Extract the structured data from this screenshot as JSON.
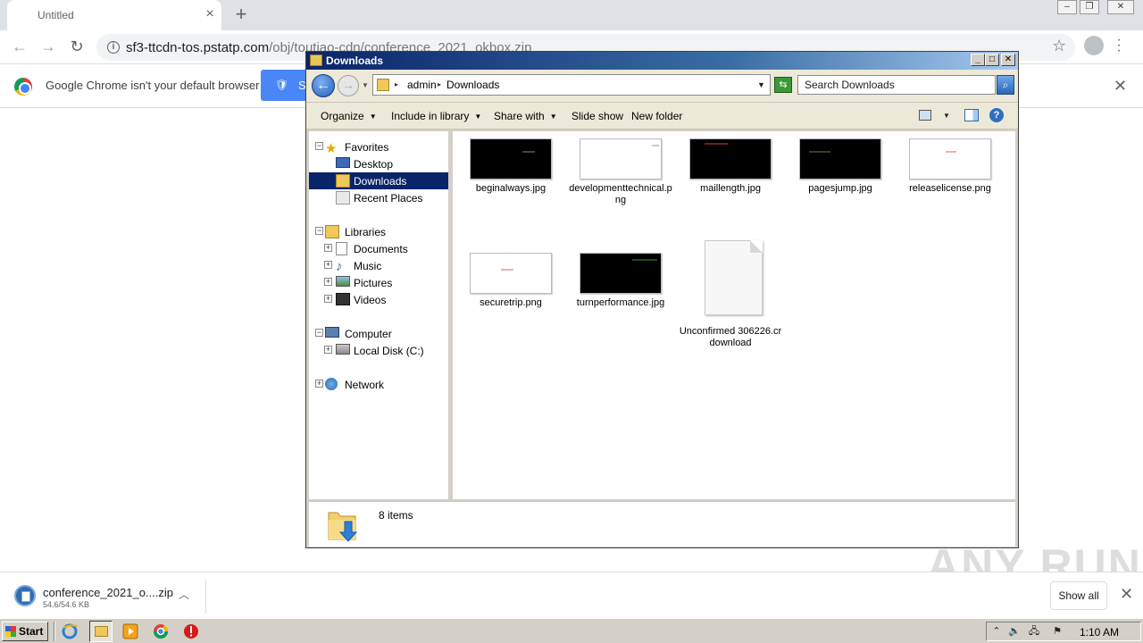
{
  "browser": {
    "tab_title": "Untitled",
    "url_host": "sf3-ttcdn-tos.pstatp.com",
    "url_path": "/obj/toutiao-cdn/conference_2021_okbox.zip",
    "infobar_text": "Google Chrome isn't your default browser",
    "set_default_label": "S"
  },
  "explorer": {
    "title": "Downloads",
    "breadcrumbs": [
      "admin",
      "Downloads"
    ],
    "search_placeholder": "Search Downloads",
    "commands": [
      "Organize",
      "Include in library",
      "Share with",
      "Slide show",
      "New folder"
    ],
    "tree": {
      "favorites": "Favorites",
      "desktop": "Desktop",
      "downloads": "Downloads",
      "recent": "Recent Places",
      "libraries": "Libraries",
      "documents": "Documents",
      "music": "Music",
      "pictures": "Pictures",
      "videos": "Videos",
      "computer": "Computer",
      "local_disk": "Local Disk (C:)",
      "network": "Network"
    },
    "files": [
      {
        "name": "beginalways.jpg",
        "thumb": "dark"
      },
      {
        "name": "developmenttechnical.png",
        "thumb": "light"
      },
      {
        "name": "maillength.jpg",
        "thumb": "dark"
      },
      {
        "name": "pagesjump.jpg",
        "thumb": "dark"
      },
      {
        "name": "releaselicense.png",
        "thumb": "light"
      },
      {
        "name": "securetrip.png",
        "thumb": "light"
      },
      {
        "name": "turnperformance.jpg",
        "thumb": "dark"
      },
      {
        "name": "Unconfirmed 306226.crdownload",
        "thumb": "doc"
      }
    ],
    "item_count": "8 items"
  },
  "download_bar": {
    "file_name": "conference_2021_o....zip",
    "progress": "54.6/54.6 KB",
    "show_all": "Show all"
  },
  "watermark": "ANY RUN",
  "taskbar": {
    "start": "Start",
    "clock": "1:10 AM"
  }
}
